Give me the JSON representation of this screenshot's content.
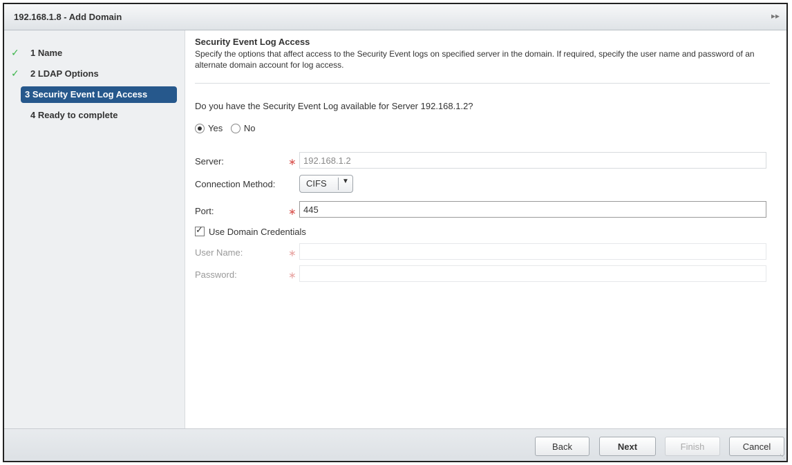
{
  "window": {
    "title": "192.168.1.8 - Add Domain",
    "expand_icon": "double-chevron-right-icon"
  },
  "steps": [
    {
      "label": "1 Name",
      "state": "done"
    },
    {
      "label": "2 LDAP Options",
      "state": "done"
    },
    {
      "label": "3 Security Event Log Access",
      "state": "active"
    },
    {
      "label": "4 Ready to complete",
      "state": "pending"
    }
  ],
  "section": {
    "title": "Security Event Log Access",
    "description": "Specify the options that affect access to the Security Event logs on specified server in the domain. If required, specify the user name and password of an alternate domain account for log access."
  },
  "question": "Do you have the Security Event Log available for Server 192.168.1.2?",
  "radios": {
    "yes": "Yes",
    "no": "No",
    "selected": "yes"
  },
  "form": {
    "server_label": "Server:",
    "server_value": "192.168.1.2",
    "connection_label": "Connection Method:",
    "connection_value": "CIFS",
    "port_label": "Port:",
    "port_value": "445",
    "use_domain_label": "Use Domain Credentials",
    "use_domain_checked": true,
    "username_label": "User Name:",
    "username_value": "",
    "password_label": "Password:",
    "password_value": ""
  },
  "buttons": {
    "back": "Back",
    "next": "Next",
    "finish": "Finish",
    "cancel": "Cancel"
  },
  "colors": {
    "accent": "#26588c",
    "check": "#3bb54a",
    "required": "#d9534f"
  }
}
